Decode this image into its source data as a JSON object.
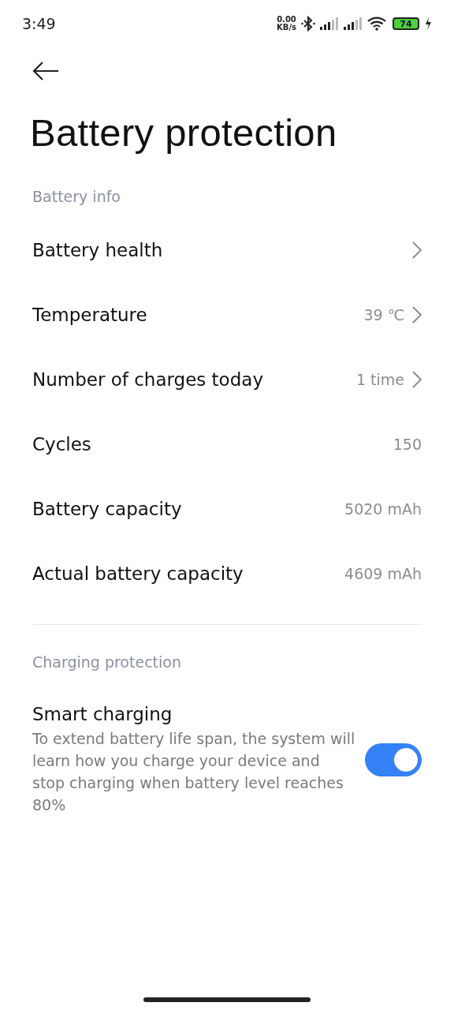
{
  "status_bar": {
    "time": "3:49",
    "net_speed": "0.00",
    "net_unit": "KB/s",
    "battery": "74"
  },
  "title": "Battery protection",
  "sections": [
    {
      "header": "Battery info",
      "items": [
        {
          "label": "Battery health",
          "chevron": true
        },
        {
          "label": "Temperature",
          "value": "39 ℃",
          "chevron": true
        },
        {
          "label": "Number of charges today",
          "value": "1 time",
          "chevron": true
        },
        {
          "label": "Cycles",
          "value": "150",
          "chevron": false
        },
        {
          "label": "Battery capacity",
          "value": "5020 mAh",
          "chevron": false
        },
        {
          "label": "Actual battery capacity",
          "value": "4609 mAh",
          "chevron": false
        }
      ]
    },
    {
      "header": "Charging protection",
      "toggles": [
        {
          "label": "Smart charging",
          "description": "To extend battery life span, the system will learn how you charge your device and stop charging when battery level reaches 80%",
          "on": true
        }
      ]
    }
  ]
}
